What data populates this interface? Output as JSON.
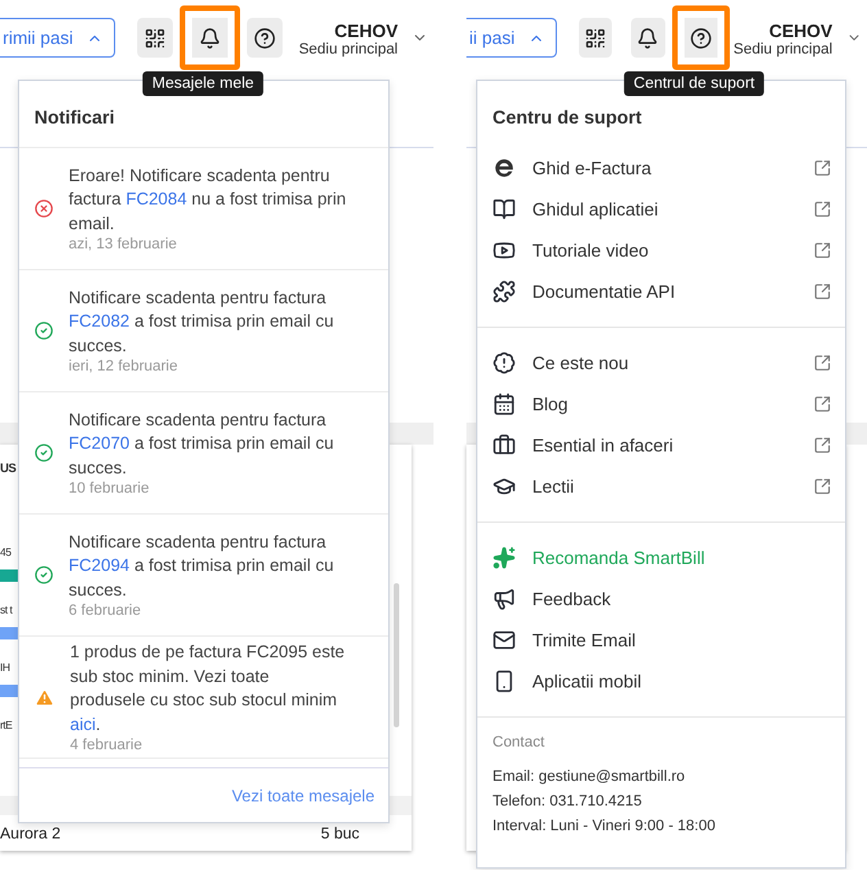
{
  "left": {
    "toolbar": {
      "start_button": "rimii pasi",
      "user": "CEHOV",
      "branch": "Sediu principal",
      "buttons": [
        {
          "kind": "add-grid",
          "highlighted": false
        },
        {
          "kind": "bell",
          "highlighted": true
        },
        {
          "kind": "help",
          "highlighted": false
        }
      ]
    },
    "tooltip": "Mesajele mele",
    "background_rows": [
      {
        "kind": "heading",
        "text": "US"
      },
      {
        "kind": "text",
        "text": "45"
      },
      {
        "kind": "bar",
        "color": "#17a893"
      },
      {
        "kind": "text",
        "text": "st t"
      },
      {
        "kind": "bar",
        "color": "#6fa3f7"
      },
      {
        "kind": "text",
        "text": "IH"
      },
      {
        "kind": "bar",
        "color": "#6fa3f7"
      },
      {
        "kind": "text",
        "text": "rtE"
      }
    ],
    "table_row": {
      "product": "Aurora 2",
      "quantity": "5 buc"
    },
    "notifications": {
      "title": "Notificari",
      "items": [
        {
          "kind": "error",
          "before": "Eroare! Notificare scadenta pentru factura ",
          "link": "FC2084",
          "after": " nu a fost trimisa prin email.",
          "date": "azi, 13 februarie"
        },
        {
          "kind": "success",
          "before": "Notificare scadenta pentru factura ",
          "link": "FC2082",
          "after": " a fost trimisa prin email cu succes.",
          "date": "ieri, 12 februarie"
        },
        {
          "kind": "success",
          "before": "Notificare scadenta pentru factura ",
          "link": "FC2070",
          "after": " a fost trimisa prin email cu succes.",
          "date": "10 februarie"
        },
        {
          "kind": "success",
          "before": "Notificare scadenta pentru factura ",
          "link": "FC2094",
          "after": " a fost trimisa prin email cu succes.",
          "date": "6 februarie"
        },
        {
          "kind": "warning",
          "before": "1 produs de pe factura FC2095 este sub stoc minim. Vezi toate produsele cu stoc sub stocul minim ",
          "link": "aici",
          "after": ".",
          "date": "4 februarie"
        }
      ],
      "footer_link": "Vezi toate mesajele"
    }
  },
  "right": {
    "toolbar": {
      "start_button": "ii pasi",
      "user": "CEHOV",
      "branch": "Sediu principal",
      "buttons": [
        {
          "kind": "add-grid",
          "highlighted": false
        },
        {
          "kind": "bell",
          "highlighted": false
        },
        {
          "kind": "help",
          "highlighted": true
        }
      ]
    },
    "tooltip": "Centrul de suport",
    "support": {
      "title": "Centru de suport",
      "groups": [
        [
          {
            "label": "Ghid e-Factura",
            "external": true,
            "accent": false
          },
          {
            "label": "Ghidul aplicatiei",
            "external": true,
            "accent": false
          },
          {
            "label": "Tutoriale video",
            "external": true,
            "accent": false
          },
          {
            "label": "Documentatie API",
            "external": true,
            "accent": false
          }
        ],
        [
          {
            "label": "Ce este nou",
            "external": true,
            "accent": false
          },
          {
            "label": "Blog",
            "external": true,
            "accent": false
          },
          {
            "label": "Esential in afaceri",
            "external": true,
            "accent": false
          },
          {
            "label": "Lectii",
            "external": true,
            "accent": false
          }
        ],
        [
          {
            "label": "Recomanda SmartBill",
            "external": false,
            "accent": true
          },
          {
            "label": "Feedback",
            "external": false,
            "accent": false
          },
          {
            "label": "Trimite Email",
            "external": false,
            "accent": false
          },
          {
            "label": "Aplicatii mobil",
            "external": false,
            "accent": false
          }
        ]
      ],
      "contact": {
        "title": "Contact",
        "lines": [
          "Email: gestiune@smartbill.ro",
          "Telefon: 031.710.4215",
          "Interval: Luni - Vineri 9:00 - 18:00"
        ]
      }
    }
  }
}
